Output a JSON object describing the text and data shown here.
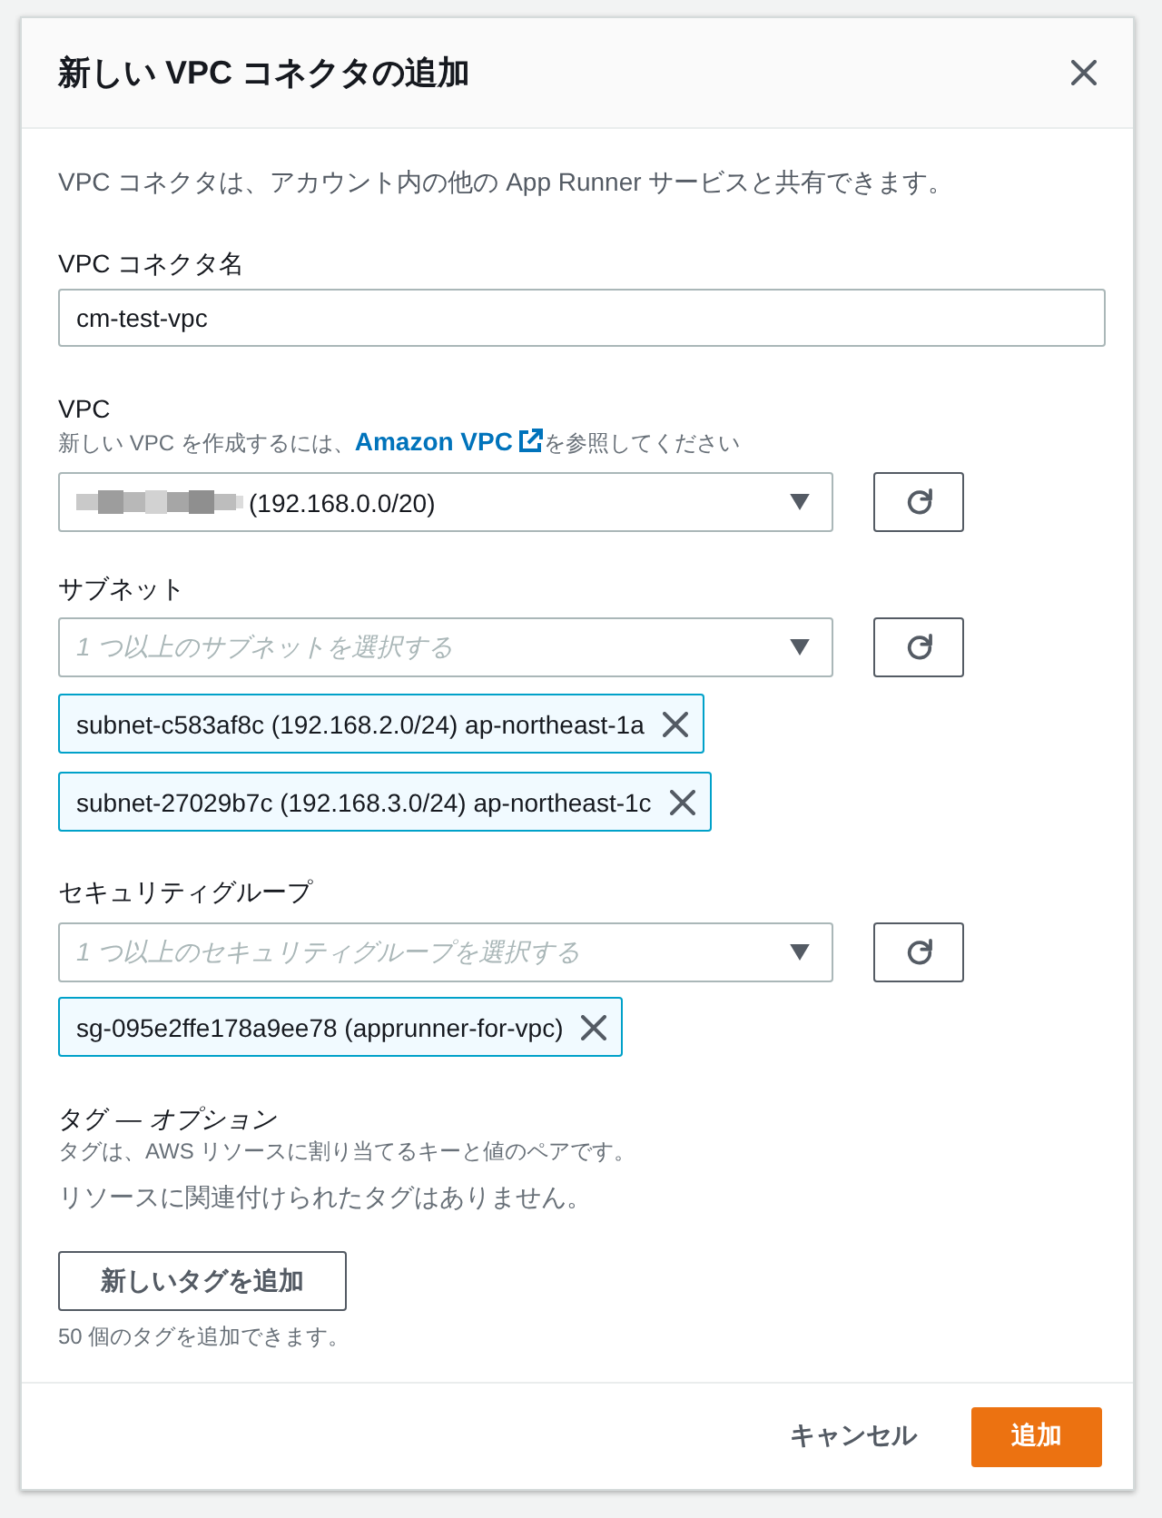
{
  "dialog": {
    "title": "新しい VPC コネクタの追加"
  },
  "intro": "VPC コネクタは、アカウント内の他の App Runner サービスと共有できます。",
  "name_field": {
    "label": "VPC コネクタ名",
    "value": "cm-test-vpc"
  },
  "vpc": {
    "label": "VPC",
    "hint_before": "新しい VPC を作成するには、",
    "link": "Amazon VPC",
    "hint_after": "を参照してください",
    "value": "(192.168.0.0/20)",
    "masked": true
  },
  "subnets": {
    "label": "サブネット",
    "placeholder": "1 つ以上のサブネットを選択する",
    "tokens": [
      "subnet-c583af8c (192.168.2.0/24) ap-northeast-1a",
      "subnet-27029b7c (192.168.3.0/24) ap-northeast-1c"
    ]
  },
  "security_groups": {
    "label": "セキュリティグループ",
    "placeholder": "1 つ以上のセキュリティグループを選択する",
    "tokens": [
      "sg-095e2ffe178a9ee78 (apprunner-for-vpc)"
    ]
  },
  "tags": {
    "title": "タグ *— オプション*",
    "description": "タグは、AWS リソースに割り当てるキーと値のペアです。",
    "empty": "リソースに関連付けられたタグはありません。",
    "add_button": "新しいタグを追加",
    "limit_note": "50 個のタグを追加できます。"
  },
  "footer": {
    "cancel": "キャンセル",
    "submit": "追加"
  }
}
